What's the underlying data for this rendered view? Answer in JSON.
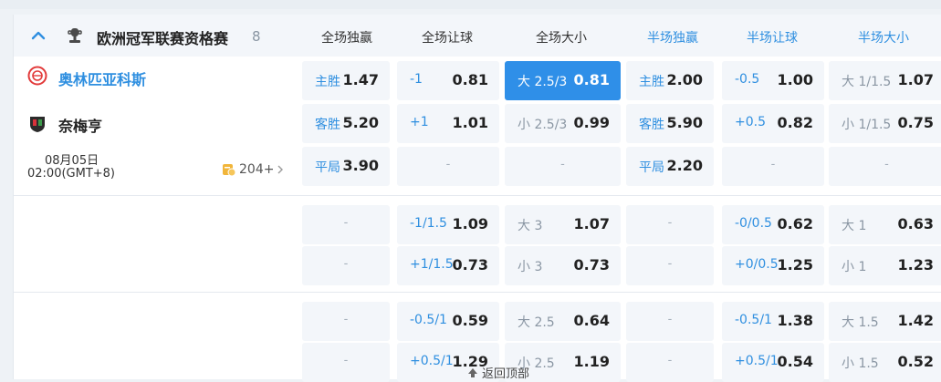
{
  "league": {
    "name": "欧洲冠军联赛资格赛",
    "count": "8"
  },
  "columns": [
    "全场独赢",
    "全场让球",
    "全场大小",
    "半场独赢",
    "半场让球",
    "半场大小"
  ],
  "match": {
    "home": "奥林匹亚科斯",
    "away": "奈梅亨",
    "date": "08月05日",
    "time": "02:00(GMT+8)",
    "more_count": "204+"
  },
  "rows": [
    [
      [
        "主胜",
        "1.47"
      ],
      [
        "-1",
        "0.81"
      ],
      [
        "大 2.5/3",
        "0.81"
      ],
      [
        "主胜",
        "2.00"
      ],
      [
        "-0.5",
        "1.00"
      ],
      [
        "大 1/1.5",
        "1.07"
      ]
    ],
    [
      [
        "客胜",
        "5.20"
      ],
      [
        "+1",
        "1.01"
      ],
      [
        "小 2.5/3",
        "0.99"
      ],
      [
        "客胜",
        "5.90"
      ],
      [
        "+0.5",
        "0.82"
      ],
      [
        "小 1/1.5",
        "0.75"
      ]
    ],
    [
      [
        "平局",
        "3.90"
      ],
      [
        "-",
        ""
      ],
      [
        "-",
        ""
      ],
      [
        "平局",
        "2.20"
      ],
      [
        "-",
        ""
      ],
      [
        "-",
        ""
      ]
    ],
    [
      [
        "-",
        ""
      ],
      [
        "-1/1.5",
        "1.09"
      ],
      [
        "大 3",
        "1.07"
      ],
      [
        "-",
        ""
      ],
      [
        "-0/0.5",
        "0.62"
      ],
      [
        "大 1",
        "0.63"
      ]
    ],
    [
      [
        "-",
        ""
      ],
      [
        "+1/1.5",
        "0.73"
      ],
      [
        "小 3",
        "0.73"
      ],
      [
        "-",
        ""
      ],
      [
        "+0/0.5",
        "1.25"
      ],
      [
        "小 1",
        "1.23"
      ]
    ],
    [
      [
        "-",
        ""
      ],
      [
        "-0.5/1",
        "0.59"
      ],
      [
        "大 2.5",
        "0.64"
      ],
      [
        "-",
        ""
      ],
      [
        "-0.5/1",
        "1.38"
      ],
      [
        "大 1.5",
        "1.42"
      ]
    ],
    [
      [
        "-",
        ""
      ],
      [
        "+0.5/1",
        "1.29"
      ],
      [
        "小 2.5",
        "1.19"
      ],
      [
        "-",
        ""
      ],
      [
        "+0.5/1",
        "0.54"
      ],
      [
        "小 1.5",
        "0.52"
      ]
    ]
  ],
  "back_to_top": "返回顶部",
  "colors": {
    "accent": "#2f8fe0",
    "selected_bg": "#2f8fe8",
    "cell_bg": "#f3f6fa"
  }
}
